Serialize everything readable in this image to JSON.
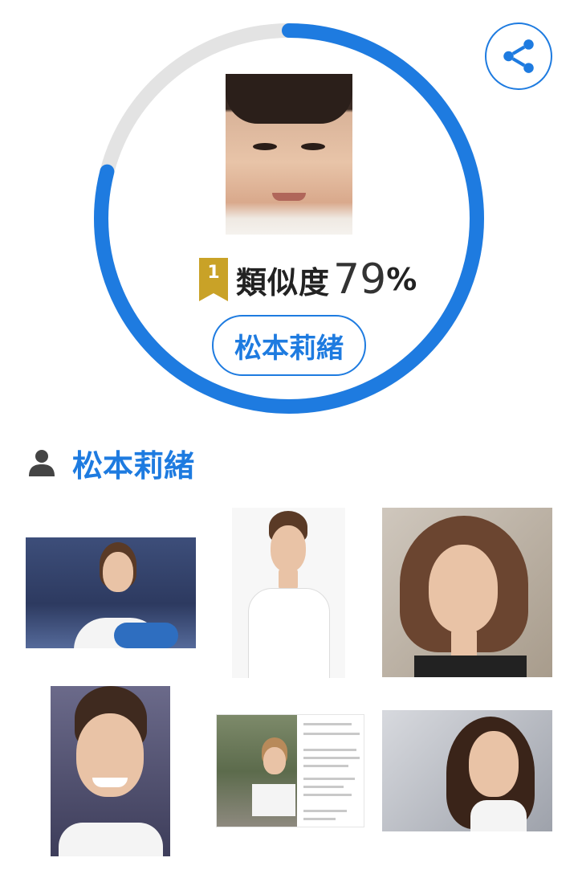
{
  "result": {
    "rank": "1",
    "similarity_label": "類似度",
    "similarity_value": "79",
    "similarity_unit": "%",
    "similarity_fraction": 0.79,
    "name": "松本莉緒"
  },
  "person": {
    "name": "松本莉緒"
  },
  "colors": {
    "accent": "#1e7be0",
    "track": "#e3e3e3",
    "badge": "#c9a227"
  },
  "icons": {
    "share": "share-icon",
    "person": "person-icon",
    "rank": "rank-ribbon-icon"
  },
  "gallery_count_label": ""
}
